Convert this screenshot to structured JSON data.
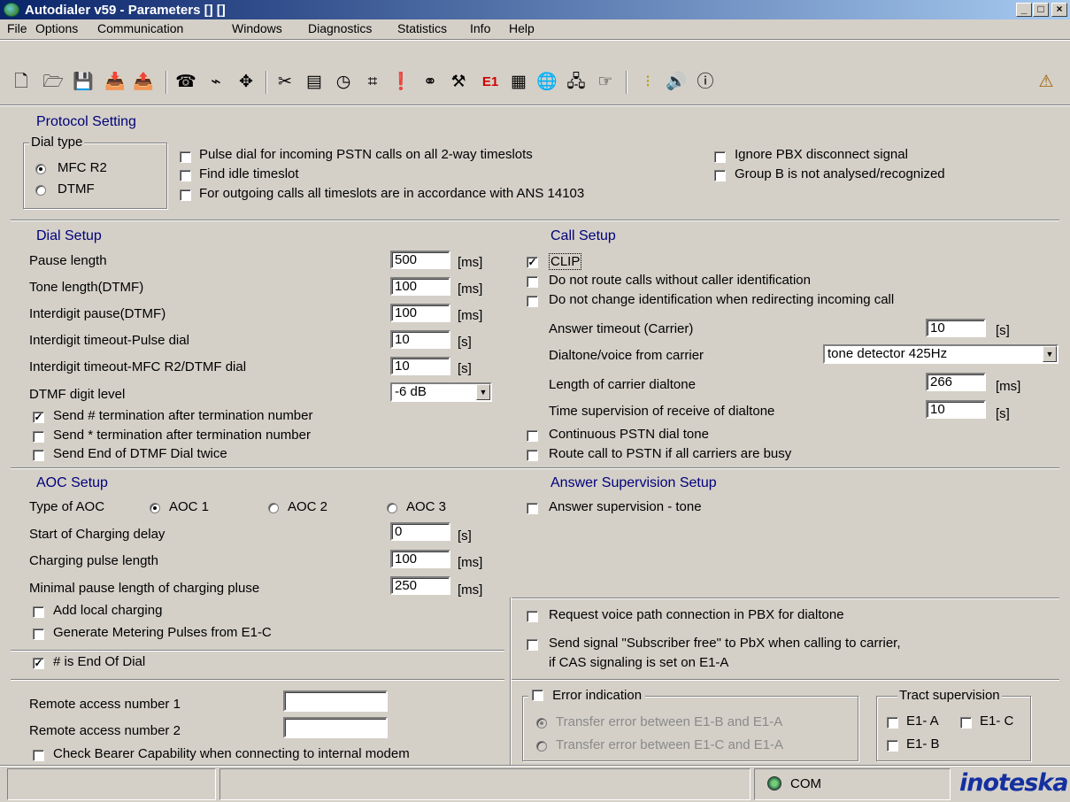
{
  "window": {
    "title": "Autodialer v59 - Parameters [] []",
    "controls": [
      "_",
      "□",
      "×"
    ]
  },
  "menu": [
    "File",
    "Options",
    "Communication",
    "Windows",
    "Diagnostics",
    "Statistics",
    "Info",
    "Help"
  ],
  "toolbar": {
    "e1_label": "E1",
    "icons": [
      "new-icon",
      "open-icon",
      "save-icon",
      "import-icon",
      "export-icon",
      "phone-icon",
      "cable-icon",
      "move-icon",
      "cut-icon",
      "log-icon",
      "clock-icon",
      "hash-icon",
      "alarm-icon",
      "link-icon",
      "tools-icon",
      "e1-icon",
      "calendar-icon",
      "globe-icon",
      "network-icon",
      "pointer-icon",
      "traffic-light-icon",
      "sound-icon",
      "info-icon",
      "warning-icon"
    ]
  },
  "protocol": {
    "section_title": "Protocol Setting",
    "dial_type_label": "Dial type",
    "dial_types": [
      {
        "label": "MFC R2",
        "selected": true
      },
      {
        "label": "DTMF",
        "selected": false
      }
    ],
    "options": [
      {
        "label": "Pulse dial for incoming PSTN calls on all 2-way timeslots",
        "checked": false
      },
      {
        "label": "Find idle timeslot",
        "checked": false
      },
      {
        "label": "For outgoing calls all timeslots are in accordance with ANS 14103",
        "checked": false
      },
      {
        "label": "Ignore PBX disconnect signal",
        "checked": false
      },
      {
        "label": "Group B is not analysed/recognized",
        "checked": false
      }
    ]
  },
  "dial_setup": {
    "section_title": "Dial Setup",
    "fields": [
      {
        "label": "Pause length",
        "value": "500",
        "unit": "[ms]"
      },
      {
        "label": "Tone length(DTMF)",
        "value": "100",
        "unit": "[ms]"
      },
      {
        "label": "Interdigit pause(DTMF)",
        "value": "100",
        "unit": "[ms]"
      },
      {
        "label": "Interdigit timeout-Pulse dial",
        "value": "10",
        "unit": "[s]"
      },
      {
        "label": "Interdigit timeout-MFC R2/DTMF dial",
        "value": "10",
        "unit": "[s]"
      }
    ],
    "dtmf_level_label": "DTMF digit level",
    "dtmf_level_value": "-6 dB",
    "options": [
      {
        "label": "Send # termination after termination number",
        "checked": true
      },
      {
        "label": "Send * termination after termination number",
        "checked": false
      },
      {
        "label": "Send End of DTMF Dial twice",
        "checked": false
      }
    ]
  },
  "call_setup": {
    "section_title": "Call Setup",
    "options_top": [
      {
        "label": "CLIP",
        "checked": true
      },
      {
        "label": "Do not route calls without caller identification",
        "checked": false
      },
      {
        "label": "Do not change identification when redirecting incoming call",
        "checked": false
      }
    ],
    "answer_timeout": {
      "label": "Answer timeout (Carrier)",
      "value": "10",
      "unit": "[s]"
    },
    "dialtone": {
      "label": "Dialtone/voice from carrier",
      "value": "tone detector 425Hz"
    },
    "carrier_dialtone": {
      "label": "Length of carrier dialtone",
      "value": "266",
      "unit": "[ms]"
    },
    "time_supervision": {
      "label": "Time supervision of receive of dialtone",
      "value": "10",
      "unit": "[s]"
    },
    "options_bottom": [
      {
        "label": "Continuous PSTN dial tone",
        "checked": false
      },
      {
        "label": "Route call to PSTN if all carriers are busy",
        "checked": false
      }
    ]
  },
  "aoc": {
    "section_title": "AOC Setup",
    "type_label": "Type of AOC",
    "types": [
      {
        "label": "AOC 1",
        "selected": true
      },
      {
        "label": "AOC 2",
        "selected": false
      },
      {
        "label": "AOC 3",
        "selected": false
      }
    ],
    "fields": [
      {
        "label": "Start of Charging delay",
        "value": "0",
        "unit": "[s]"
      },
      {
        "label": "Charging pulse length",
        "value": "100",
        "unit": "[ms]"
      },
      {
        "label": "Minimal pause length of charging pluse",
        "value": "250",
        "unit": "[ms]"
      }
    ],
    "options": [
      {
        "label": "Add local charging",
        "checked": false
      },
      {
        "label": "Generate Metering Pulses from E1-C",
        "checked": false
      }
    ],
    "end_of_dial": {
      "label": "# is End Of Dial",
      "checked": true
    }
  },
  "answer_supervision": {
    "section_title": "Answer Supervision Setup",
    "tone": {
      "label": "Answer supervision - tone",
      "checked": false
    },
    "voice_path": {
      "label": "Request voice path connection in PBX for dialtone",
      "checked": false
    },
    "subscriber_free": {
      "label": "Send signal \"Subscriber free\" to PbX when calling to carrier,",
      "label2": "if CAS signaling is set on E1-A",
      "checked": false
    }
  },
  "remote": {
    "number1_label": "Remote access number 1",
    "number1_value": "",
    "number2_label": "Remote access number 2",
    "number2_value": "",
    "bearer": {
      "label": "Check Bearer Capability when connecting to internal modem",
      "checked": false
    }
  },
  "error_indication": {
    "label": "Error indication",
    "checked": false,
    "options": [
      {
        "label": "Transfer error between E1-B and E1-A",
        "selected": true
      },
      {
        "label": "Transfer error between E1-C and E1-A",
        "selected": false
      }
    ]
  },
  "tract": {
    "label": "Tract supervision",
    "items": [
      {
        "label": "E1- A",
        "checked": false
      },
      {
        "label": "E1- C",
        "checked": false
      },
      {
        "label": "E1- B",
        "checked": false
      }
    ]
  },
  "status": {
    "com_label": "COM",
    "logo": "inoteska"
  },
  "colors": {
    "section_title": "#00007b",
    "title_bar_start": "#0a246a",
    "title_bar_end": "#a6caf0",
    "face": "#d4d0c8"
  }
}
